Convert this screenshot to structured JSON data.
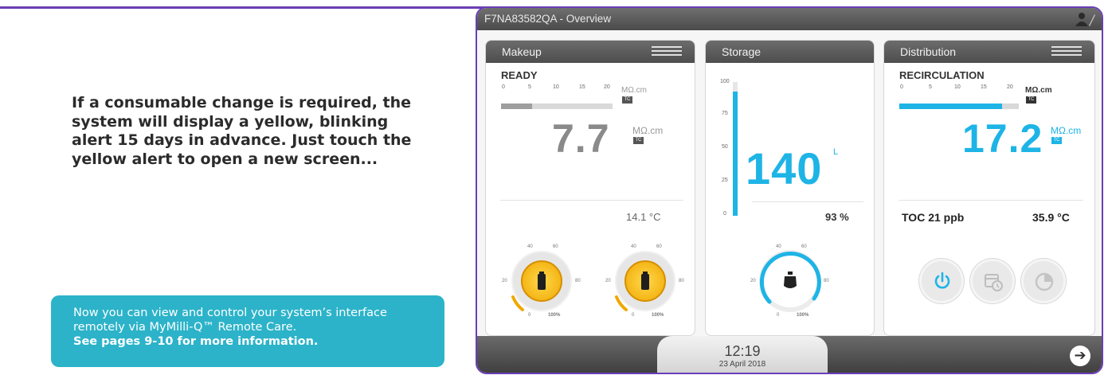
{
  "intro_text": "If a consumable change is required, the system will display a yellow, blinking alert 15 days in advance. Just touch the yellow alert to open a new screen...",
  "callout": {
    "text": "Now you can view and control your system’s interface remotely via MyMilli-Q™ Remote Care.",
    "bold": "See pages 9-10 for more information."
  },
  "device": {
    "title": "F7NA83582QA - Overview",
    "time": "12:19",
    "date": "23 April 2018",
    "panels": {
      "makeup": {
        "title": "Makeup",
        "state": "READY",
        "scale_labels": [
          "0",
          "5",
          "10",
          "15",
          "20"
        ],
        "scale_unit": "MΩ.cm",
        "tc": "TC",
        "bar_fraction": 0.28,
        "value": "7.7",
        "value_unit": "MΩ.cm",
        "temp": "14.1 °C",
        "gauge_labels": [
          "0",
          "40",
          "60",
          "20",
          "80",
          "100%"
        ],
        "accent": "#f0a800"
      },
      "storage": {
        "title": "Storage",
        "scale_labels": [
          "100",
          "75",
          "50",
          "25",
          "0"
        ],
        "level_fraction": 0.93,
        "value": "140",
        "value_unit": "L",
        "percent": "93 %",
        "gauge_labels": [
          "0",
          "40",
          "60",
          "20",
          "80",
          "100%"
        ],
        "accent": "#1eb4e6"
      },
      "distribution": {
        "title": "Distribution",
        "state": "RECIRCULATION",
        "scale_labels": [
          "0",
          "5",
          "10",
          "15",
          "20"
        ],
        "scale_unit": "MΩ.cm",
        "tc": "TC",
        "bar_fraction": 0.86,
        "value": "17.2",
        "value_unit": "MΩ.cm",
        "toc": "TOC 21 ppb",
        "temp": "35.9 °C",
        "accent": "#1eb4e6"
      }
    }
  }
}
